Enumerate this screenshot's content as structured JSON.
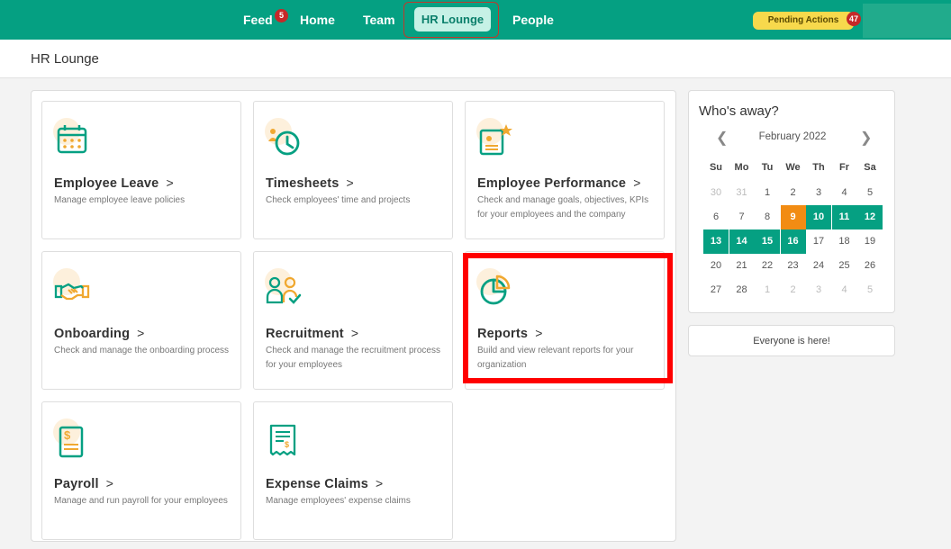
{
  "nav": {
    "items": [
      {
        "label": "Feed",
        "badge": "5"
      },
      {
        "label": "Home"
      },
      {
        "label": "Team"
      },
      {
        "label": "HR Lounge",
        "active": true
      },
      {
        "label": "People"
      }
    ],
    "pending_label": "Pending Actions",
    "pending_count": "47"
  },
  "page": {
    "title": "HR Lounge"
  },
  "cards": [
    {
      "title": "Employee Leave",
      "desc": "Manage employee leave policies",
      "icon": "calendar-icon"
    },
    {
      "title": "Timesheets",
      "desc": "Check employees' time and projects",
      "icon": "clock-icon"
    },
    {
      "title": "Employee Performance",
      "desc": "Check and manage goals, objectives, KPIs for your employees and the company",
      "icon": "performance-star-icon"
    },
    {
      "title": "Onboarding",
      "desc": "Check and manage the onboarding process",
      "icon": "handshake-icon"
    },
    {
      "title": "Recruitment",
      "desc": "Check and manage the recruitment process for your employees",
      "icon": "recruit-people-icon"
    },
    {
      "title": "Reports",
      "desc": "Build and view relevant reports for your organization",
      "icon": "pie-chart-icon"
    },
    {
      "title": "Payroll",
      "desc": "Manage and run payroll for your employees",
      "icon": "payroll-document-icon"
    },
    {
      "title": "Expense Claims",
      "desc": "Manage employees' expense claims",
      "icon": "receipt-icon"
    }
  ],
  "away": {
    "title": "Who's away?",
    "month": "February 2022",
    "weekdays": [
      "Su",
      "Mo",
      "Tu",
      "We",
      "Th",
      "Fr",
      "Sa"
    ],
    "weeks": [
      [
        "30",
        "31",
        "1",
        "2",
        "3",
        "4",
        "5"
      ],
      [
        "6",
        "7",
        "8",
        "9",
        "10",
        "11",
        "12"
      ],
      [
        "13",
        "14",
        "15",
        "16",
        "17",
        "18",
        "19"
      ],
      [
        "20",
        "21",
        "22",
        "23",
        "24",
        "25",
        "26"
      ],
      [
        "27",
        "28",
        "1",
        "2",
        "3",
        "4",
        "5"
      ]
    ],
    "muted_days": [
      "30",
      "31"
    ],
    "today": "9",
    "away_days": [
      "10",
      "11",
      "12",
      "13",
      "14",
      "15",
      "16"
    ],
    "everyone_here": "Everyone is here!"
  },
  "colors": {
    "brand": "#05a082",
    "today": "#f28c13",
    "highlight": "#ff0000",
    "badge": "#c62828",
    "pending": "#f7d94c"
  }
}
